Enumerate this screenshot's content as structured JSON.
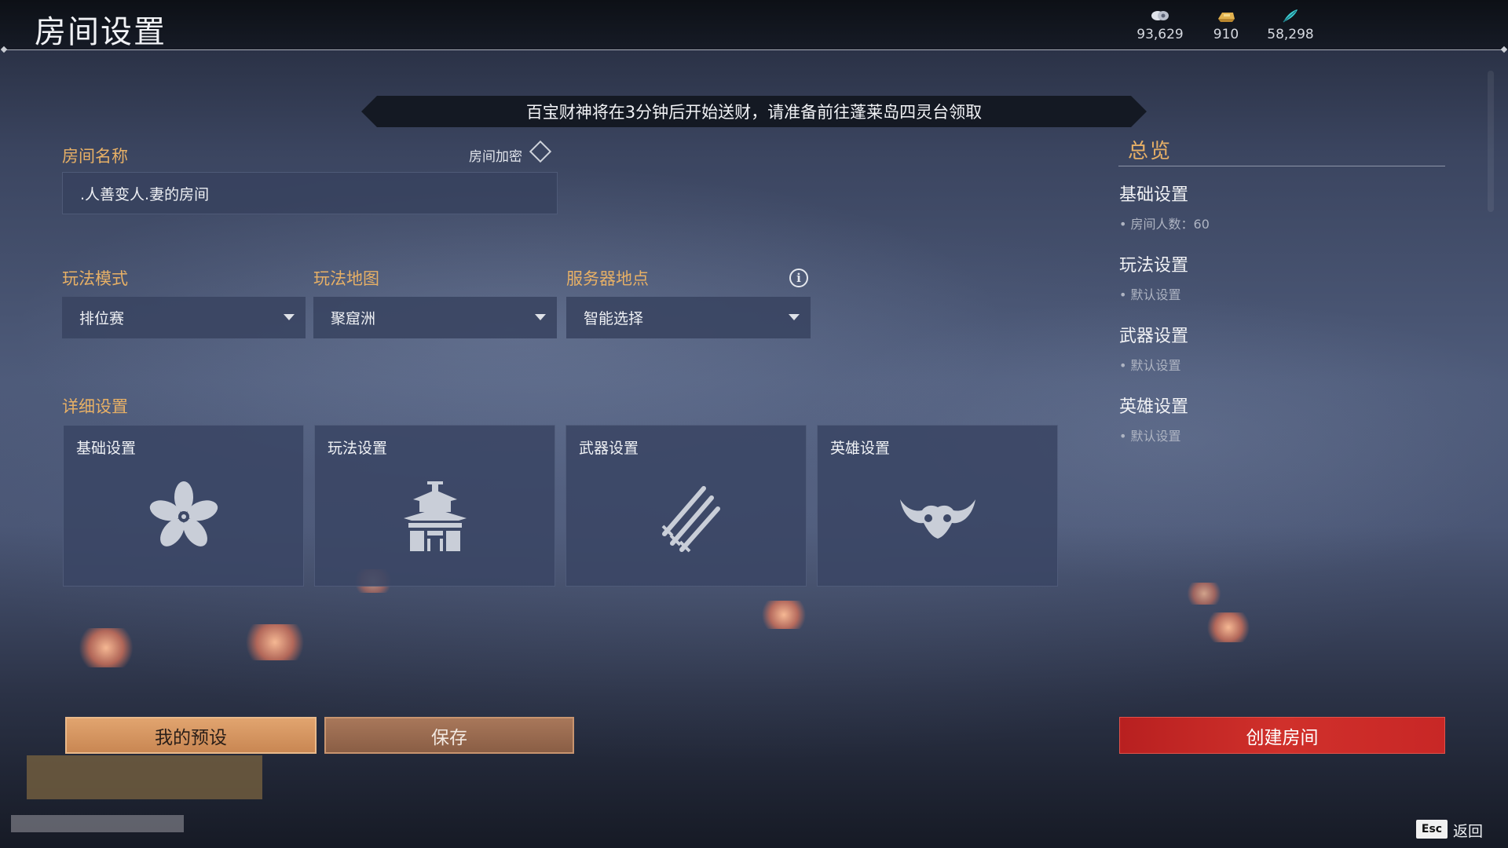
{
  "header": {
    "title": "房间设置",
    "currencies": [
      {
        "icon": "coin-stack-icon",
        "value": "93,629"
      },
      {
        "icon": "gold-ingot-icon",
        "value": "910"
      },
      {
        "icon": "jade-feather-icon",
        "value": "58,298"
      }
    ]
  },
  "announcement": "百宝财神将在3分钟后开始送财，请准备前往蓬莱岛四灵台领取",
  "room": {
    "name_label": "房间名称",
    "name_value": ".人善变人.妻的房间",
    "lock_label": "房间加密"
  },
  "selectors": {
    "mode_label": "玩法模式",
    "mode_value": "排位赛",
    "map_label": "玩法地图",
    "map_value": "聚窟洲",
    "server_label": "服务器地点",
    "server_value": "智能选择"
  },
  "details": {
    "label": "详细设置",
    "cards": [
      {
        "title": "基础设置",
        "icon": "flower-icon"
      },
      {
        "title": "玩法设置",
        "icon": "pagoda-icon"
      },
      {
        "title": "武器设置",
        "icon": "swords-icon"
      },
      {
        "title": "英雄设置",
        "icon": "horned-mask-icon"
      }
    ]
  },
  "summary": {
    "title": "总览",
    "sections": [
      {
        "heading": "基础设置",
        "detail": "• 房间人数：60"
      },
      {
        "heading": "玩法设置",
        "detail": "• 默认设置"
      },
      {
        "heading": "武器设置",
        "detail": "• 默认设置"
      },
      {
        "heading": "英雄设置",
        "detail": "• 默认设置"
      }
    ]
  },
  "buttons": {
    "preset": "我的预设",
    "save": "保存",
    "create": "创建房间"
  },
  "footer": {
    "esc_key": "Esc",
    "back": "返回"
  },
  "colors": {
    "accent_label": "#e7b066",
    "create_button": "#c8292a",
    "preset_button": "#d4935e"
  }
}
